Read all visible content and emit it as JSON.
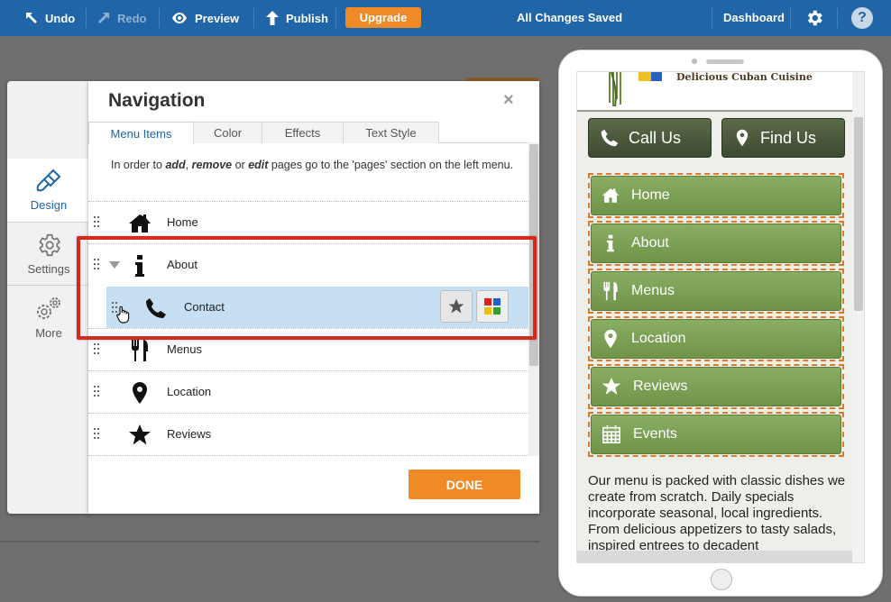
{
  "toolbar": {
    "undo": "Undo",
    "redo": "Redo",
    "preview": "Preview",
    "publish": "Publish",
    "upgrade": "Upgrade",
    "status": "All Changes Saved",
    "dashboard": "Dashboard",
    "help": "?"
  },
  "sidebar": {
    "items": [
      {
        "label": "Design",
        "icon": "brush-icon",
        "active": true
      },
      {
        "label": "Settings",
        "icon": "gear-icon",
        "active": false
      },
      {
        "label": "More",
        "icon": "gears-icon",
        "active": false
      }
    ]
  },
  "dialog": {
    "title": "Navigation",
    "close": "×",
    "tabs": [
      "Menu Items",
      "Color",
      "Effects",
      "Text Style"
    ],
    "active_tab": "Menu Items",
    "info_pre": "In order to ",
    "info_add": "add",
    "info_sep1": ", ",
    "info_remove": "remove",
    "info_or": " or ",
    "info_edit": "edit",
    "info_post": " pages go to the 'pages' section on the left menu.",
    "items": [
      {
        "label": "Home",
        "icon": "home-icon"
      },
      {
        "label": "About",
        "icon": "info-icon"
      },
      {
        "label": "Contact",
        "icon": "phone-icon"
      },
      {
        "label": "Menus",
        "icon": "fork-knife-icon"
      },
      {
        "label": "Location",
        "icon": "map-pin-icon"
      },
      {
        "label": "Reviews",
        "icon": "star-icon"
      }
    ],
    "done": "DONE"
  },
  "preview": {
    "logo_text": "Delicious Cuban Cuisine",
    "cta": [
      "Call Us",
      "Find Us"
    ],
    "menu": [
      "Home",
      "About",
      "Menus",
      "Location",
      "Reviews",
      "Events"
    ],
    "body_text": "Our menu is packed with classic dishes we create from scratch. Daily specials incorporate seasonal, local ingredients. From delicious appetizers to tasty salads, inspired entrees to decadent"
  },
  "colors": {
    "topbar": "#1f65a8",
    "accent_orange": "#f08a26",
    "highlight_red": "#d42a1e",
    "menu_green": "#7ea257",
    "selected_row": "#c6dff2"
  }
}
